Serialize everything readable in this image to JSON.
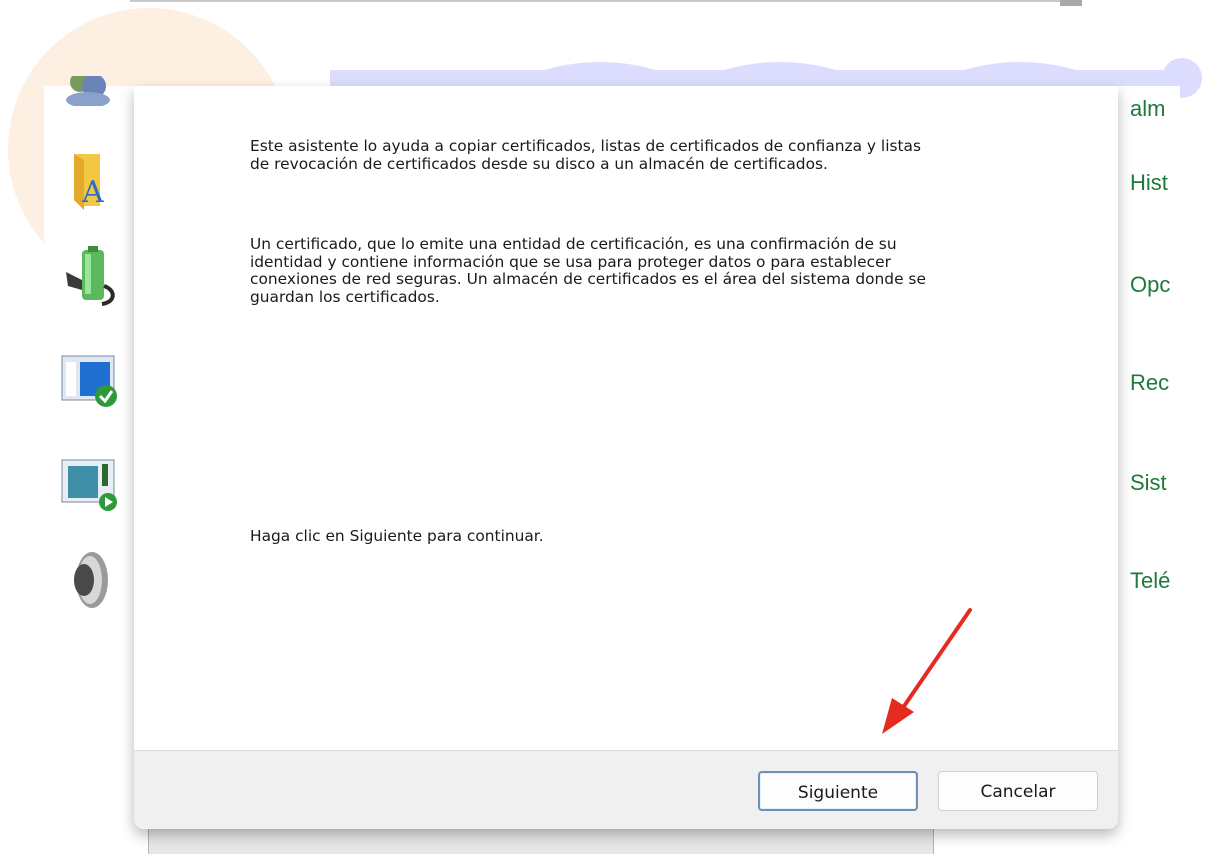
{
  "wizard": {
    "paragraph1": "Este asistente lo ayuda a copiar certificados, listas de certificados de confianza y listas\nde revocación de certificados desde su disco a un almacén de certificados.",
    "paragraph2": "Un certificado, que lo emite una entidad de certificación, es una confirmación de su\nidentidad y contiene información que se usa para proteger datos o para establecer\nconexiones de red seguras. Un almacén de certificados es el área del sistema donde se\nguardan los certificados.",
    "instruction": "Haga clic en Siguiente para continuar.",
    "next_label": "Siguiente",
    "cancel_label": "Cancelar"
  },
  "right_panel": {
    "links": [
      "alm",
      "Hist",
      "Opc",
      "Rec",
      "Sist",
      "Telé"
    ],
    "link_color": "#1e7a3a"
  },
  "left_panel": {
    "icons": [
      "users-icon",
      "folder-font-icon",
      "battery-power-icon",
      "window-check-icon",
      "display-play-icon",
      "speaker-icon"
    ]
  },
  "annotation": {
    "arrow_color": "#e52b1f"
  }
}
